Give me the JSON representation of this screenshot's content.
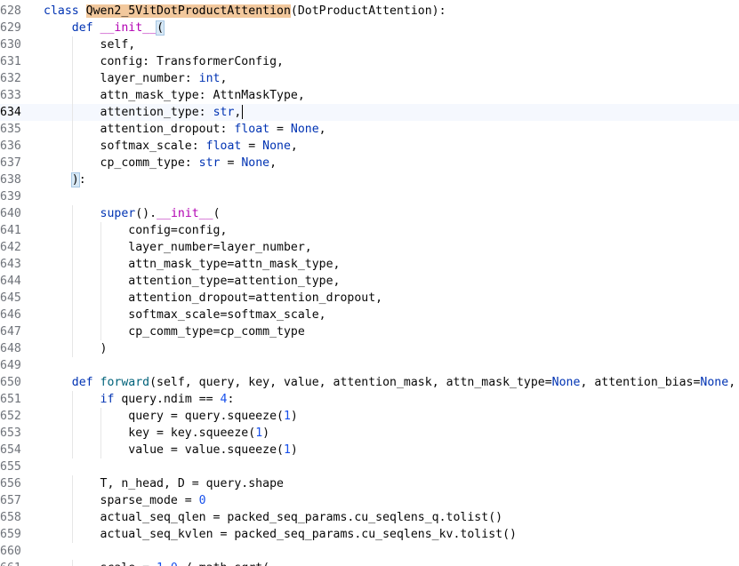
{
  "editor": {
    "current_line": "634",
    "lines": [
      {
        "num": "628",
        "parts": [
          [
            "kw",
            "class "
          ],
          [
            "cls-hl",
            "Qwen2_5VitDotProductAttention"
          ],
          [
            "plain",
            "(DotProductAttention):"
          ]
        ]
      },
      {
        "num": "629",
        "parts": [
          [
            "plain",
            "    "
          ],
          [
            "kw",
            "def "
          ],
          [
            "dunder",
            "__init__"
          ],
          [
            "paren-hl",
            "("
          ]
        ]
      },
      {
        "num": "630",
        "parts": [
          [
            "plain",
            "        self,"
          ]
        ]
      },
      {
        "num": "631",
        "parts": [
          [
            "plain",
            "        config: TransformerConfig,"
          ]
        ]
      },
      {
        "num": "632",
        "parts": [
          [
            "plain",
            "        layer_number: "
          ],
          [
            "builtin",
            "int"
          ],
          [
            "plain",
            ","
          ]
        ]
      },
      {
        "num": "633",
        "parts": [
          [
            "plain",
            "        attn_mask_type: AttnMaskType,"
          ]
        ]
      },
      {
        "num": "634",
        "parts": [
          [
            "plain",
            "        attention_type: "
          ],
          [
            "builtin",
            "str"
          ],
          [
            "plain",
            ","
          ]
        ]
      },
      {
        "num": "635",
        "parts": [
          [
            "plain",
            "        attention_dropout: "
          ],
          [
            "builtin",
            "float"
          ],
          [
            "plain",
            " = "
          ],
          [
            "kw",
            "None"
          ],
          [
            "plain",
            ","
          ]
        ]
      },
      {
        "num": "636",
        "parts": [
          [
            "plain",
            "        softmax_scale: "
          ],
          [
            "builtin",
            "float"
          ],
          [
            "plain",
            " = "
          ],
          [
            "kw",
            "None"
          ],
          [
            "plain",
            ","
          ]
        ]
      },
      {
        "num": "637",
        "parts": [
          [
            "plain",
            "        cp_comm_type: "
          ],
          [
            "builtin",
            "str"
          ],
          [
            "plain",
            " = "
          ],
          [
            "kw",
            "None"
          ],
          [
            "plain",
            ","
          ]
        ]
      },
      {
        "num": "638",
        "parts": [
          [
            "plain",
            "    "
          ],
          [
            "paren-hl",
            ")"
          ],
          [
            "plain",
            ":"
          ]
        ]
      },
      {
        "num": "639",
        "parts": [
          [
            "plain",
            ""
          ]
        ]
      },
      {
        "num": "640",
        "parts": [
          [
            "plain",
            "        "
          ],
          [
            "builtin",
            "super"
          ],
          [
            "plain",
            "()."
          ],
          [
            "dunder",
            "__init__"
          ],
          [
            "plain",
            "("
          ]
        ]
      },
      {
        "num": "641",
        "parts": [
          [
            "plain",
            "            config=config,"
          ]
        ]
      },
      {
        "num": "642",
        "parts": [
          [
            "plain",
            "            layer_number=layer_number,"
          ]
        ]
      },
      {
        "num": "643",
        "parts": [
          [
            "plain",
            "            attn_mask_type=attn_mask_type,"
          ]
        ]
      },
      {
        "num": "644",
        "parts": [
          [
            "plain",
            "            attention_type=attention_type,"
          ]
        ]
      },
      {
        "num": "645",
        "parts": [
          [
            "plain",
            "            attention_dropout=attention_dropout,"
          ]
        ]
      },
      {
        "num": "646",
        "parts": [
          [
            "plain",
            "            softmax_scale=softmax_scale,"
          ]
        ]
      },
      {
        "num": "647",
        "parts": [
          [
            "plain",
            "            cp_comm_type=cp_comm_type"
          ]
        ]
      },
      {
        "num": "648",
        "parts": [
          [
            "plain",
            "        )"
          ]
        ]
      },
      {
        "num": "649",
        "parts": [
          [
            "plain",
            ""
          ]
        ]
      },
      {
        "num": "650",
        "parts": [
          [
            "plain",
            "    "
          ],
          [
            "kw",
            "def "
          ],
          [
            "fn",
            "forward"
          ],
          [
            "plain",
            "(self, query, key, value, attention_mask, attn_mask_type="
          ],
          [
            "kw",
            "None"
          ],
          [
            "plain",
            ", attention_bias="
          ],
          [
            "kw",
            "None"
          ],
          [
            "plain",
            ", packed_seq_params="
          ]
        ]
      },
      {
        "num": "651",
        "parts": [
          [
            "plain",
            "        "
          ],
          [
            "kw",
            "if "
          ],
          [
            "plain",
            "query.ndim == "
          ],
          [
            "num",
            "4"
          ],
          [
            "plain",
            ":"
          ]
        ]
      },
      {
        "num": "652",
        "parts": [
          [
            "plain",
            "            query = query.squeeze("
          ],
          [
            "num",
            "1"
          ],
          [
            "plain",
            ")"
          ]
        ]
      },
      {
        "num": "653",
        "parts": [
          [
            "plain",
            "            key = key.squeeze("
          ],
          [
            "num",
            "1"
          ],
          [
            "plain",
            ")"
          ]
        ]
      },
      {
        "num": "654",
        "parts": [
          [
            "plain",
            "            value = value.squeeze("
          ],
          [
            "num",
            "1"
          ],
          [
            "plain",
            ")"
          ]
        ]
      },
      {
        "num": "655",
        "parts": [
          [
            "plain",
            ""
          ]
        ]
      },
      {
        "num": "656",
        "parts": [
          [
            "plain",
            "        T, n_head, D = query.shape"
          ]
        ]
      },
      {
        "num": "657",
        "parts": [
          [
            "plain",
            "        sparse_mode = "
          ],
          [
            "num",
            "0"
          ]
        ]
      },
      {
        "num": "658",
        "parts": [
          [
            "plain",
            "        actual_seq_qlen = packed_seq_params.cu_seqlens_q.tolist()"
          ]
        ]
      },
      {
        "num": "659",
        "parts": [
          [
            "plain",
            "        actual_seq_kvlen = packed_seq_params.cu_seqlens_kv.tolist()"
          ]
        ]
      },
      {
        "num": "660",
        "parts": [
          [
            "plain",
            ""
          ]
        ]
      },
      {
        "num": "661",
        "parts": [
          [
            "plain",
            "        scale = "
          ],
          [
            "num",
            "1.0"
          ],
          [
            "plain",
            " / math.sqrt("
          ]
        ]
      }
    ]
  },
  "colors": {
    "keyword": "#0033b3",
    "class_highlight": "#f2c89d",
    "dunder": "#b200b2",
    "number": "#1750eb",
    "function": "#00627a",
    "line_number": "#6f737a"
  }
}
